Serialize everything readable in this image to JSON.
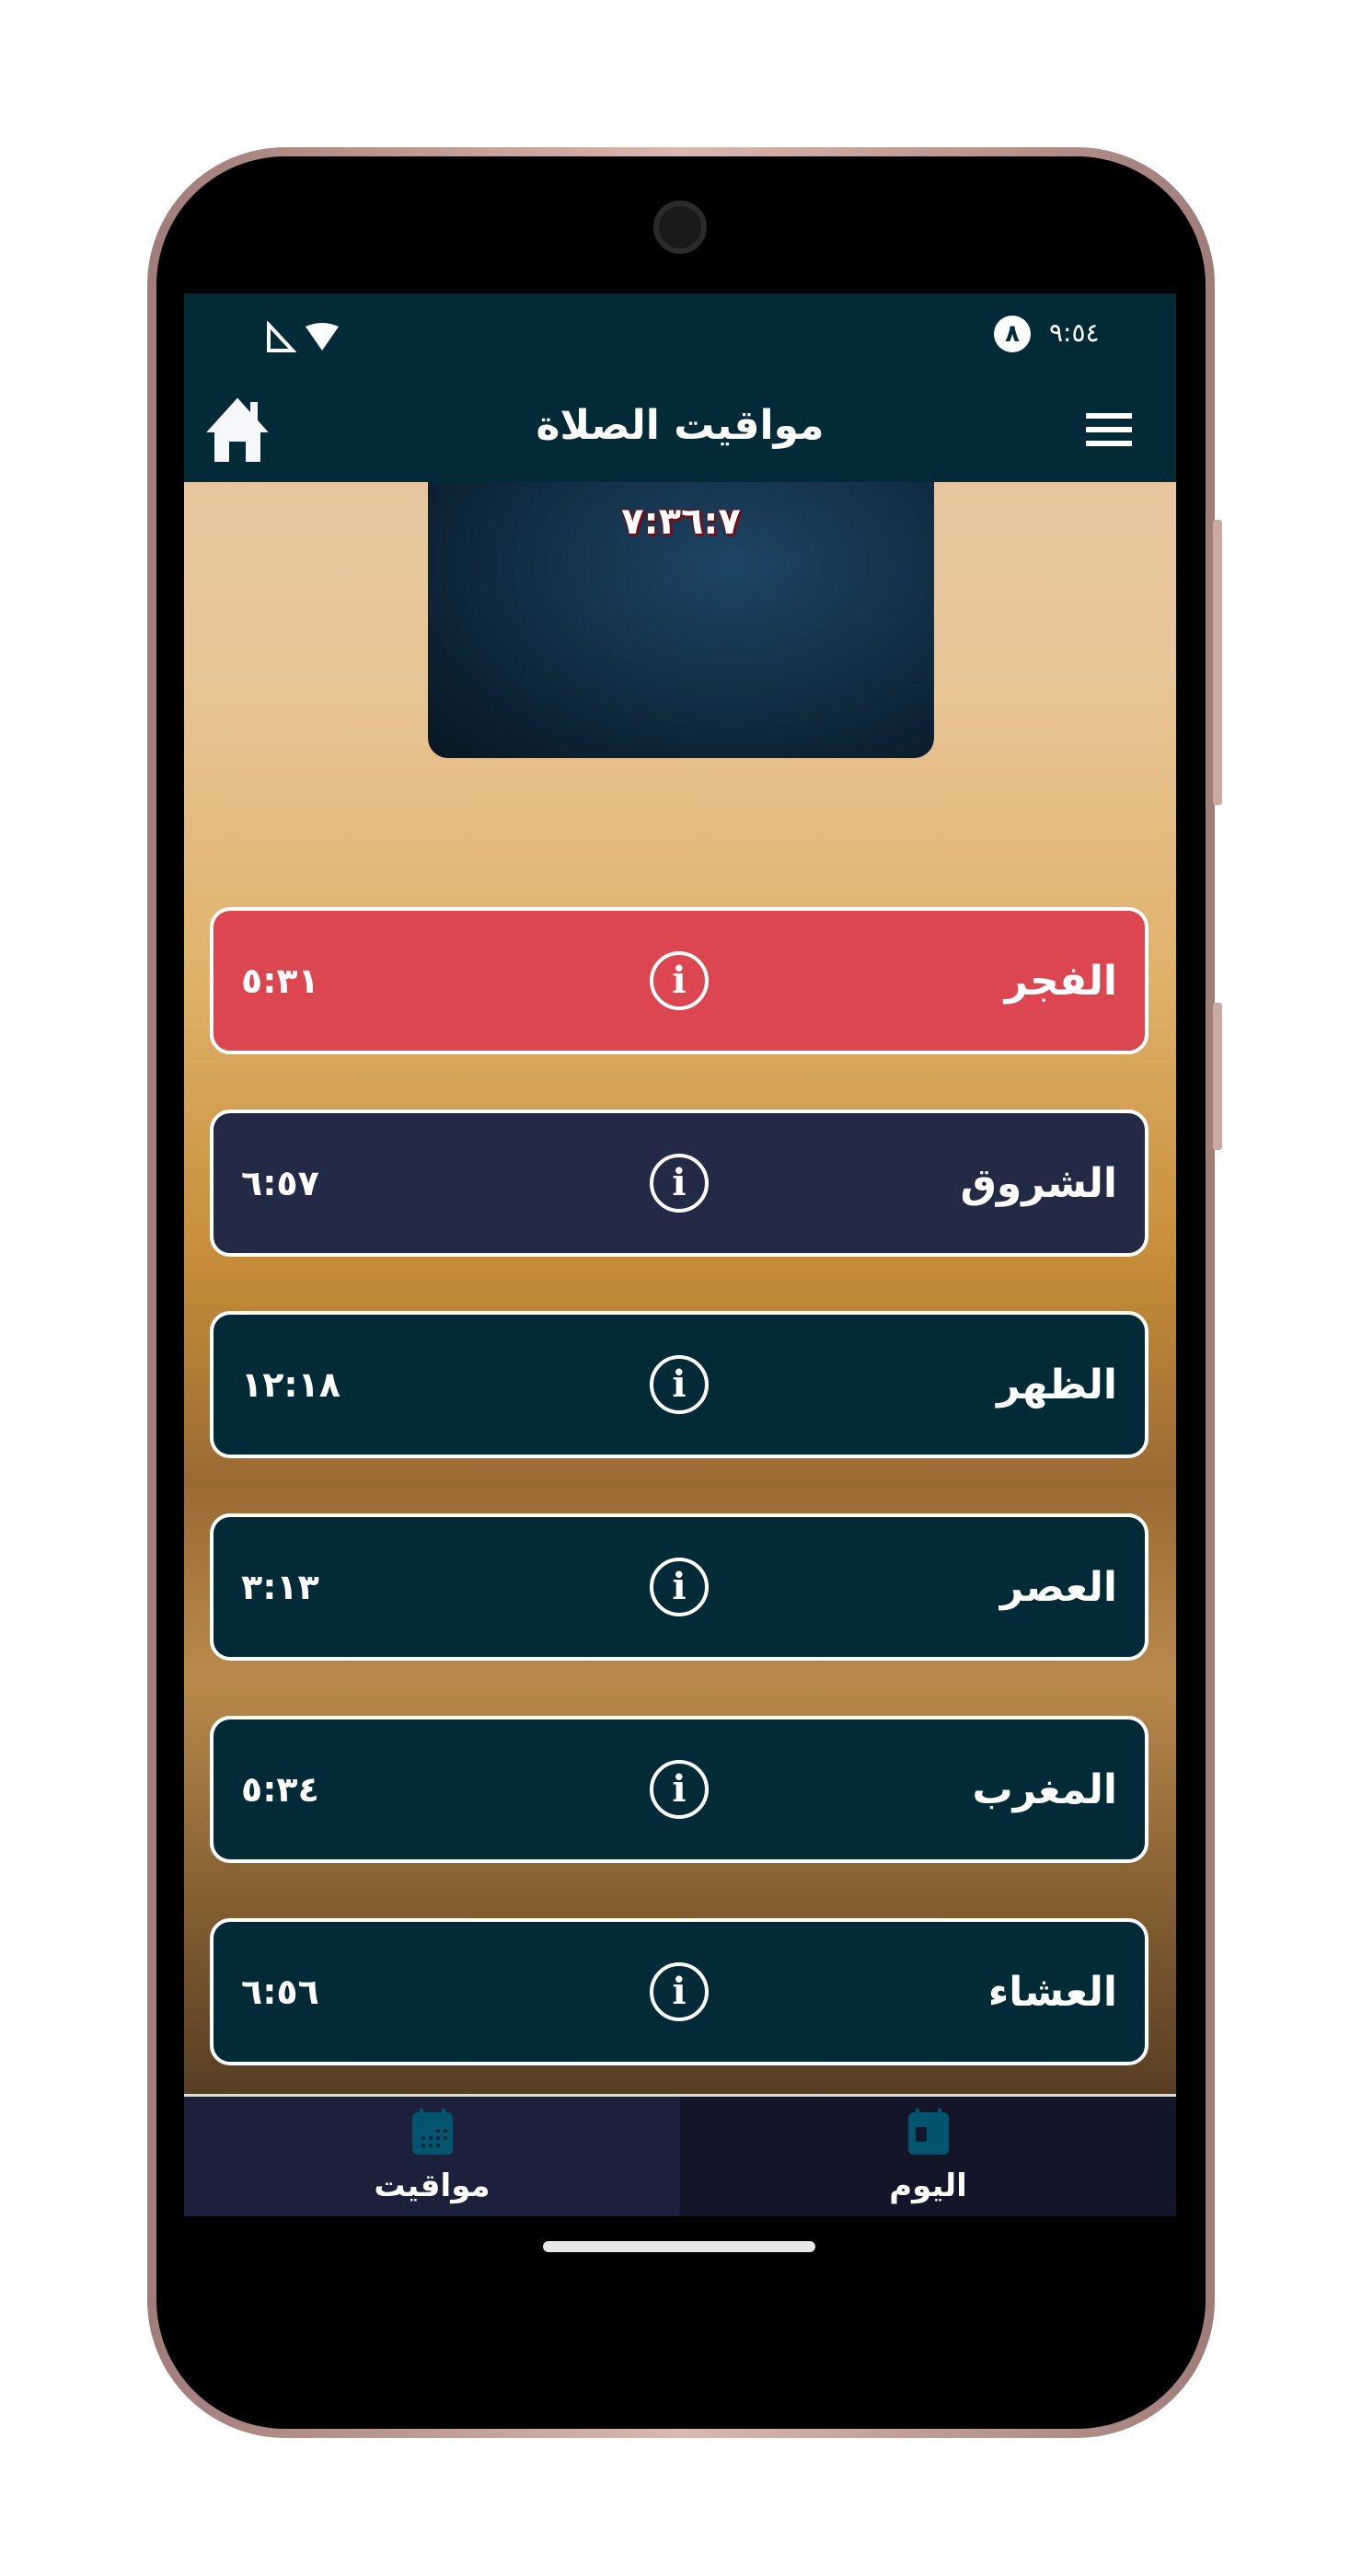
{
  "status_bar": {
    "time": "٩:٥٤",
    "notification_badge": "٨"
  },
  "app_bar": {
    "title": "مواقيت الصلاة"
  },
  "countdown": "٧:٣٦:٧",
  "prayers": [
    {
      "name": "الفجر",
      "time": "٥:٣١",
      "color": "#dc4650"
    },
    {
      "name": "الشروق",
      "time": "٦:٥٧",
      "color": "#232a45"
    },
    {
      "name": "الظهر",
      "time": "١٢:١٨",
      "color": "#022a37"
    },
    {
      "name": "العصر",
      "time": "٣:١٣",
      "color": "#022a37"
    },
    {
      "name": "المغرب",
      "time": "٥:٣٤",
      "color": "#022a37"
    },
    {
      "name": "العشاء",
      "time": "٦:٥٦",
      "color": "#022a37"
    }
  ],
  "bottom_nav": [
    {
      "label": "مواقيت",
      "icon": "calendar-month-icon"
    },
    {
      "label": "اليوم",
      "icon": "calendar-day-icon"
    }
  ]
}
